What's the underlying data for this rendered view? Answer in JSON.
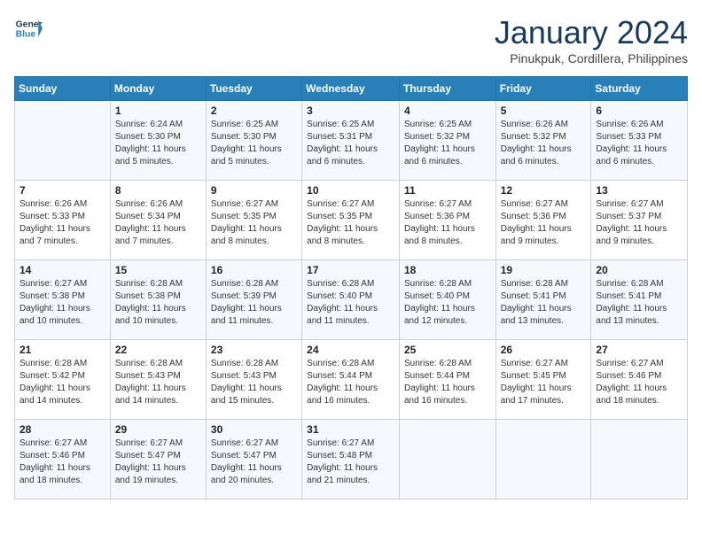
{
  "header": {
    "logo_line1": "General",
    "logo_line2": "Blue",
    "month_title": "January 2024",
    "location": "Pinukpuk, Cordillera, Philippines"
  },
  "weekdays": [
    "Sunday",
    "Monday",
    "Tuesday",
    "Wednesday",
    "Thursday",
    "Friday",
    "Saturday"
  ],
  "weeks": [
    [
      {
        "day": "",
        "info": ""
      },
      {
        "day": "1",
        "info": "Sunrise: 6:24 AM\nSunset: 5:30 PM\nDaylight: 11 hours\nand 5 minutes."
      },
      {
        "day": "2",
        "info": "Sunrise: 6:25 AM\nSunset: 5:30 PM\nDaylight: 11 hours\nand 5 minutes."
      },
      {
        "day": "3",
        "info": "Sunrise: 6:25 AM\nSunset: 5:31 PM\nDaylight: 11 hours\nand 6 minutes."
      },
      {
        "day": "4",
        "info": "Sunrise: 6:25 AM\nSunset: 5:32 PM\nDaylight: 11 hours\nand 6 minutes."
      },
      {
        "day": "5",
        "info": "Sunrise: 6:26 AM\nSunset: 5:32 PM\nDaylight: 11 hours\nand 6 minutes."
      },
      {
        "day": "6",
        "info": "Sunrise: 6:26 AM\nSunset: 5:33 PM\nDaylight: 11 hours\nand 6 minutes."
      }
    ],
    [
      {
        "day": "7",
        "info": "Sunrise: 6:26 AM\nSunset: 5:33 PM\nDaylight: 11 hours\nand 7 minutes."
      },
      {
        "day": "8",
        "info": "Sunrise: 6:26 AM\nSunset: 5:34 PM\nDaylight: 11 hours\nand 7 minutes."
      },
      {
        "day": "9",
        "info": "Sunrise: 6:27 AM\nSunset: 5:35 PM\nDaylight: 11 hours\nand 8 minutes."
      },
      {
        "day": "10",
        "info": "Sunrise: 6:27 AM\nSunset: 5:35 PM\nDaylight: 11 hours\nand 8 minutes."
      },
      {
        "day": "11",
        "info": "Sunrise: 6:27 AM\nSunset: 5:36 PM\nDaylight: 11 hours\nand 8 minutes."
      },
      {
        "day": "12",
        "info": "Sunrise: 6:27 AM\nSunset: 5:36 PM\nDaylight: 11 hours\nand 9 minutes."
      },
      {
        "day": "13",
        "info": "Sunrise: 6:27 AM\nSunset: 5:37 PM\nDaylight: 11 hours\nand 9 minutes."
      }
    ],
    [
      {
        "day": "14",
        "info": "Sunrise: 6:27 AM\nSunset: 5:38 PM\nDaylight: 11 hours\nand 10 minutes."
      },
      {
        "day": "15",
        "info": "Sunrise: 6:28 AM\nSunset: 5:38 PM\nDaylight: 11 hours\nand 10 minutes."
      },
      {
        "day": "16",
        "info": "Sunrise: 6:28 AM\nSunset: 5:39 PM\nDaylight: 11 hours\nand 11 minutes."
      },
      {
        "day": "17",
        "info": "Sunrise: 6:28 AM\nSunset: 5:40 PM\nDaylight: 11 hours\nand 11 minutes."
      },
      {
        "day": "18",
        "info": "Sunrise: 6:28 AM\nSunset: 5:40 PM\nDaylight: 11 hours\nand 12 minutes."
      },
      {
        "day": "19",
        "info": "Sunrise: 6:28 AM\nSunset: 5:41 PM\nDaylight: 11 hours\nand 13 minutes."
      },
      {
        "day": "20",
        "info": "Sunrise: 6:28 AM\nSunset: 5:41 PM\nDaylight: 11 hours\nand 13 minutes."
      }
    ],
    [
      {
        "day": "21",
        "info": "Sunrise: 6:28 AM\nSunset: 5:42 PM\nDaylight: 11 hours\nand 14 minutes."
      },
      {
        "day": "22",
        "info": "Sunrise: 6:28 AM\nSunset: 5:43 PM\nDaylight: 11 hours\nand 14 minutes."
      },
      {
        "day": "23",
        "info": "Sunrise: 6:28 AM\nSunset: 5:43 PM\nDaylight: 11 hours\nand 15 minutes."
      },
      {
        "day": "24",
        "info": "Sunrise: 6:28 AM\nSunset: 5:44 PM\nDaylight: 11 hours\nand 16 minutes."
      },
      {
        "day": "25",
        "info": "Sunrise: 6:28 AM\nSunset: 5:44 PM\nDaylight: 11 hours\nand 16 minutes."
      },
      {
        "day": "26",
        "info": "Sunrise: 6:27 AM\nSunset: 5:45 PM\nDaylight: 11 hours\nand 17 minutes."
      },
      {
        "day": "27",
        "info": "Sunrise: 6:27 AM\nSunset: 5:46 PM\nDaylight: 11 hours\nand 18 minutes."
      }
    ],
    [
      {
        "day": "28",
        "info": "Sunrise: 6:27 AM\nSunset: 5:46 PM\nDaylight: 11 hours\nand 18 minutes."
      },
      {
        "day": "29",
        "info": "Sunrise: 6:27 AM\nSunset: 5:47 PM\nDaylight: 11 hours\nand 19 minutes."
      },
      {
        "day": "30",
        "info": "Sunrise: 6:27 AM\nSunset: 5:47 PM\nDaylight: 11 hours\nand 20 minutes."
      },
      {
        "day": "31",
        "info": "Sunrise: 6:27 AM\nSunset: 5:48 PM\nDaylight: 11 hours\nand 21 minutes."
      },
      {
        "day": "",
        "info": ""
      },
      {
        "day": "",
        "info": ""
      },
      {
        "day": "",
        "info": ""
      }
    ]
  ]
}
